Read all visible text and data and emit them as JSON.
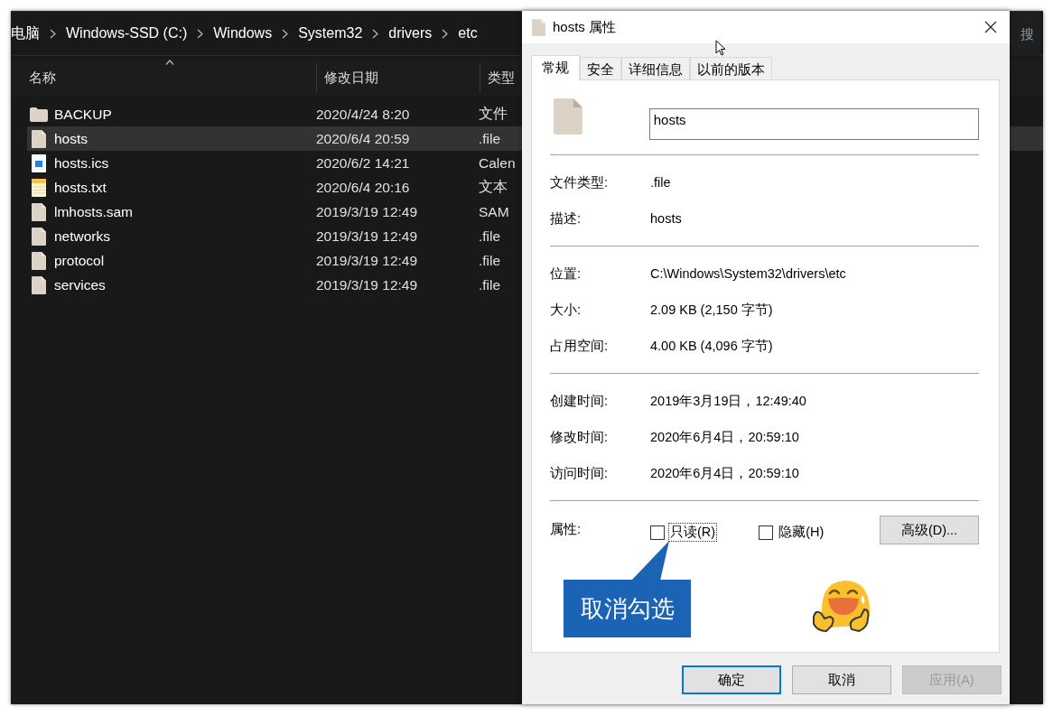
{
  "explorer": {
    "breadcrumb": [
      "电脑",
      "Windows-SSD (C:)",
      "Windows",
      "System32",
      "drivers",
      "etc"
    ],
    "search": {
      "placeholder": "搜"
    },
    "columns": [
      {
        "label": "名称",
        "sorted": true
      },
      {
        "label": "修改日期",
        "sorted": false
      },
      {
        "label": "类型",
        "sorted": false
      }
    ],
    "files": [
      {
        "name": "BACKUP",
        "date": "2020/4/24 8:20",
        "type": "文件",
        "kind": "folder",
        "selected": false
      },
      {
        "name": "hosts",
        "date": "2020/6/4 20:59",
        "type": ".file",
        "kind": "file",
        "selected": true
      },
      {
        "name": "hosts.ics",
        "date": "2020/6/2 14:21",
        "type": "Calen",
        "kind": "calendar",
        "selected": false
      },
      {
        "name": "hosts.txt",
        "date": "2020/6/4 20:16",
        "type": "文本",
        "kind": "text",
        "selected": false
      },
      {
        "name": "lmhosts.sam",
        "date": "2019/3/19 12:49",
        "type": "SAM",
        "kind": "file",
        "selected": false
      },
      {
        "name": "networks",
        "date": "2019/3/19 12:49",
        "type": ".file",
        "kind": "file",
        "selected": false
      },
      {
        "name": "protocol",
        "date": "2019/3/19 12:49",
        "type": ".file",
        "kind": "file",
        "selected": false
      },
      {
        "name": "services",
        "date": "2019/3/19 12:49",
        "type": ".file",
        "kind": "file",
        "selected": false
      }
    ]
  },
  "dialog": {
    "title": "hosts 属性",
    "tabs": [
      {
        "label": "常规",
        "selected": true
      },
      {
        "label": "安全",
        "selected": false
      },
      {
        "label": "详细信息",
        "selected": false
      },
      {
        "label": "以前的版本",
        "selected": false
      }
    ],
    "file_name": "hosts",
    "sections": [
      [
        {
          "label": "文件类型:",
          "value": ".file"
        },
        {
          "label": "描述:",
          "value": "hosts"
        }
      ],
      [
        {
          "label": "位置:",
          "value": "C:\\Windows\\System32\\drivers\\etc"
        },
        {
          "label": "大小:",
          "value": "2.09 KB (2,150 字节)"
        },
        {
          "label": "占用空间:",
          "value": "4.00 KB (4,096 字节)"
        }
      ],
      [
        {
          "label": "创建时间:",
          "value": "2019年3月19日，12:49:40"
        },
        {
          "label": "修改时间:",
          "value": "2020年6月4日，20:59:10"
        },
        {
          "label": "访问时间:",
          "value": "2020年6月4日，20:59:10"
        }
      ]
    ],
    "attributes": {
      "label": "属性:",
      "options": [
        {
          "label": "只读(R)",
          "checked": false,
          "focused": true
        },
        {
          "label": "隐藏(H)",
          "checked": false,
          "focused": false
        }
      ],
      "advanced_button": "高级(D)..."
    },
    "callout": "取消勾选",
    "buttons": [
      {
        "label": "确定",
        "default": true,
        "disabled": false
      },
      {
        "label": "取消",
        "default": false,
        "disabled": false
      },
      {
        "label": "应用(A)",
        "default": false,
        "disabled": true
      }
    ]
  }
}
